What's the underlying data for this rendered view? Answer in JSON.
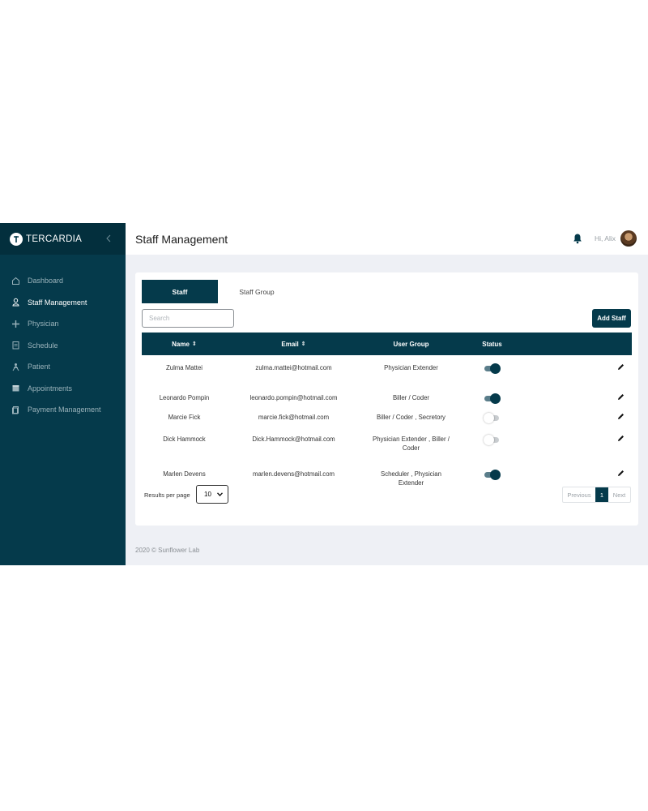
{
  "brand": {
    "name": "TERCARDIA"
  },
  "sidebar": {
    "items": [
      {
        "label": "Dashboard",
        "icon": "home-icon",
        "active": false
      },
      {
        "label": "Staff Management",
        "icon": "user-icon",
        "active": true
      },
      {
        "label": "Physician",
        "icon": "plus-icon",
        "active": false
      },
      {
        "label": "Schedule",
        "icon": "schedule-icon",
        "active": false
      },
      {
        "label": "Patient",
        "icon": "patient-icon",
        "active": false
      },
      {
        "label": "Appointments",
        "icon": "calendar-icon",
        "active": false
      },
      {
        "label": "Payment Management",
        "icon": "payment-icon",
        "active": false
      }
    ]
  },
  "header": {
    "title": "Staff Management",
    "greeting": "Hi, Alix"
  },
  "tabs": {
    "staff": "Staff",
    "staff_group": "Staff Group"
  },
  "search": {
    "placeholder": "Search",
    "value": ""
  },
  "actions": {
    "add_staff": "Add Staff"
  },
  "table": {
    "columns": {
      "name": "Name",
      "email": "Email",
      "user_group": "User Group",
      "status": "Status"
    },
    "rows": [
      {
        "name": "Zulma Mattei",
        "email": "zulma.mattei@hotmail.com",
        "user_group_lines": [
          "Physician Extender"
        ],
        "active": true
      },
      {
        "name": "Leonardo Pompin",
        "email": "leonardo.pompin@hotmail.com",
        "user_group_lines": [
          "Biller / Coder"
        ],
        "active": true
      },
      {
        "name": "Marcie Fick",
        "email": "marcie.fick@hotmail.com",
        "user_group_lines": [
          "Biller / Coder , Secretory"
        ],
        "active": false
      },
      {
        "name": "Dick Hammock",
        "email": "Dick.Hammock@hotmail.com",
        "user_group_lines": [
          "Physician Extender , Biller /",
          "Coder"
        ],
        "active": false
      },
      {
        "name": "Marlen Devens",
        "email": "marlen.devens@hotmail.com",
        "user_group_lines": [
          "Scheduler , Physician",
          "Extender"
        ],
        "active": true
      }
    ]
  },
  "pagination": {
    "results_per_page_label": "Results per page",
    "results_per_page": "10",
    "previous": "Previous",
    "current_page": "1",
    "next": "Next"
  },
  "footer": {
    "text": "2020 © Sunflower Lab"
  },
  "colors": {
    "primary": "#053a4b",
    "background": "#eef0f5"
  }
}
